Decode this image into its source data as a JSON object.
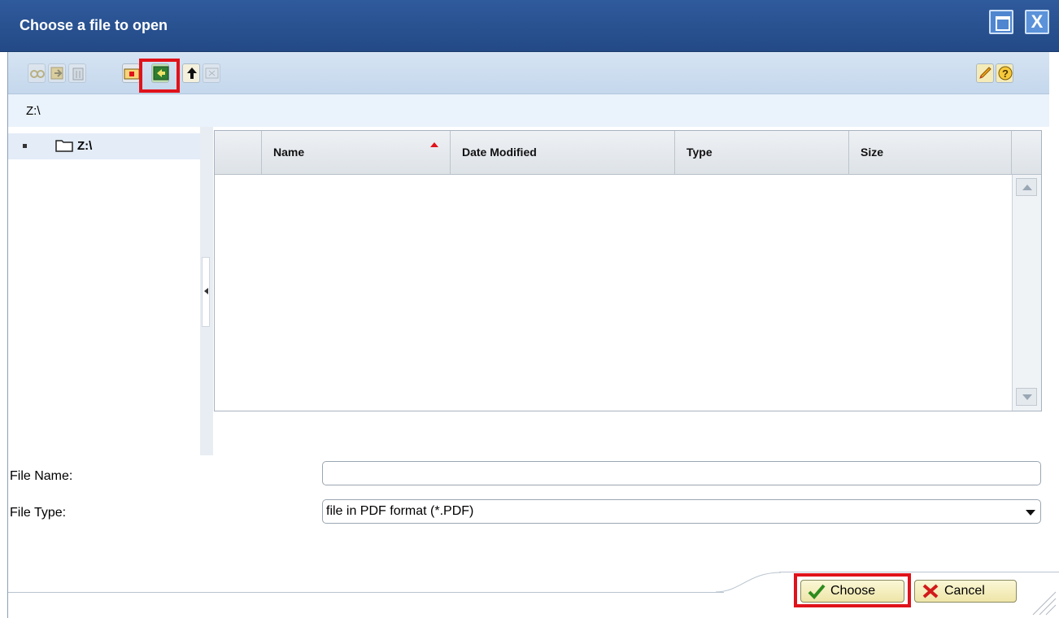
{
  "window": {
    "title": "Choose a file to open",
    "maximize_icon": "maximize-icon",
    "close_icon": "close-icon",
    "close_glyph": "X"
  },
  "toolbar": {
    "buttons": [
      {
        "name": "link-icon",
        "enabled": false
      },
      {
        "name": "rename-icon",
        "enabled": false
      },
      {
        "name": "delete-icon",
        "enabled": false
      },
      {
        "name": "new-folder-icon",
        "enabled": true
      },
      {
        "name": "refresh-icon",
        "enabled": true,
        "highlighted": true
      },
      {
        "name": "up-folder-icon",
        "enabled": true
      },
      {
        "name": "properties-icon",
        "enabled": false
      }
    ],
    "right_buttons": [
      {
        "name": "edit-pencil-icon"
      },
      {
        "name": "help-icon"
      }
    ]
  },
  "path": {
    "current": "Z:\\"
  },
  "tree": {
    "items": [
      {
        "label": "Z:\\",
        "icon": "folder-icon"
      }
    ]
  },
  "table": {
    "columns": [
      "Name",
      "Date Modified",
      "Type",
      "Size"
    ],
    "sorted_by": "Name",
    "sort_direction": "ascending",
    "rows": []
  },
  "form": {
    "file_name_label": "File Name:",
    "file_name_value": "",
    "file_type_label": "File Type:",
    "file_type_value": "file in PDF format (*.PDF)"
  },
  "footer": {
    "choose_label": "Choose",
    "cancel_label": "Cancel",
    "choose_highlighted": true
  },
  "colors": {
    "titlebar": "#2f5a9c",
    "highlight": "#e0121a",
    "toolbar": "#cfe0f1"
  }
}
